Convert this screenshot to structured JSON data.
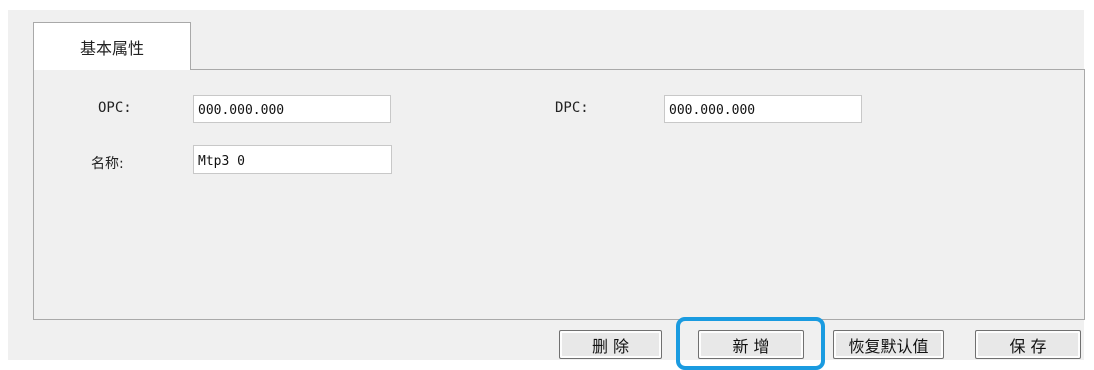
{
  "tab": {
    "label": "基本属性"
  },
  "form": {
    "opc_label": "OPC:",
    "opc_value": "000.000.000",
    "dpc_label": "DPC:",
    "dpc_value": "000.000.000",
    "name_label": "名称:",
    "name_value": "Mtp3 0"
  },
  "buttons": {
    "delete": "删 除",
    "add": "新 增",
    "restore_default": "恢复默认值",
    "save": "保 存"
  },
  "colors": {
    "highlight": "#1a9be0",
    "panel_bg": "#f0f0f0"
  }
}
